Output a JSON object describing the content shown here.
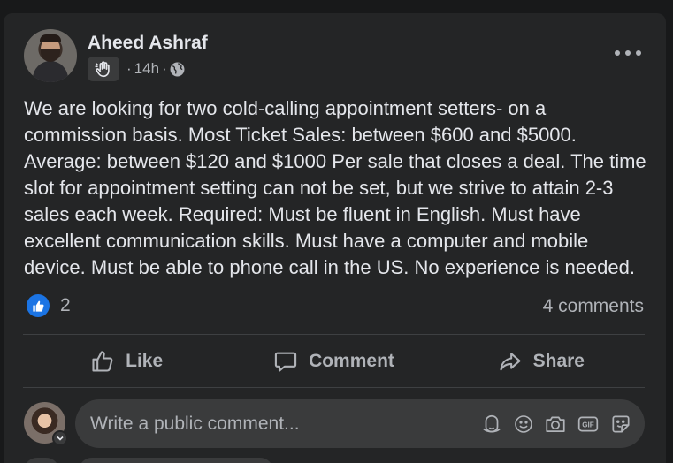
{
  "post": {
    "author": "Aheed Ashraf",
    "timestamp": "14h",
    "separator": "·",
    "audience_icon": "globe-icon",
    "badge_icon": "waving-hand-icon",
    "text": "We are looking for two cold-calling appointment setters- on a commission basis. Most Ticket Sales: between $600 and $5000. Average: between $120 and $1000 Per sale that closes a deal. The time slot for appointment setting can not be set, but we strive to attain 2-3 sales each week. Required: Must be fluent in English. Must have excellent communication skills. Must have a computer and mobile device. Must be able to phone call in the US. No experience is needed.",
    "reaction_count": "2",
    "comments_count": "4 comments"
  },
  "actions": {
    "like": "Like",
    "comment": "Comment",
    "share": "Share"
  },
  "composer": {
    "placeholder": "Write a public comment..."
  },
  "colors": {
    "card_bg": "#242526",
    "page_bg": "#18191a",
    "text_primary": "#e4e6eb",
    "text_secondary": "#b0b3b8",
    "like_blue": "#1b74e4",
    "input_bg": "#3a3b3c"
  }
}
